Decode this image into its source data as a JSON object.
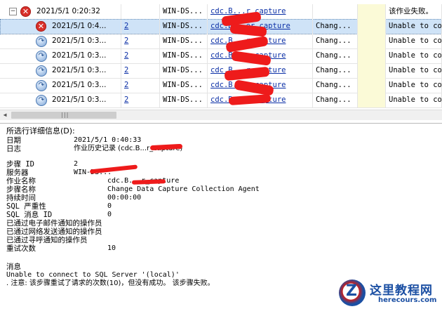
{
  "grid": {
    "rows": [
      {
        "kind": "job",
        "date": "2021/5/1 0:20:32",
        "step": "",
        "server": "WIN-DS...",
        "job": "cdc.B...r_capture",
        "name": "",
        "msg": "该作业失败。"
      },
      {
        "kind": "err",
        "date": "2021/5/1 0:4...",
        "step": "2",
        "server": "WIN-DS...",
        "job": "cdc.B...er_capture",
        "name": "Chang...",
        "msg": "Unable to co"
      },
      {
        "kind": "step",
        "date": "2021/5/1 0:3...",
        "step": "2",
        "server": "WIN-DS...",
        "job": "cdc.B...r_capture",
        "name": "Chang...",
        "msg": "Unable to co"
      },
      {
        "kind": "step",
        "date": "2021/5/1 0:3...",
        "step": "2",
        "server": "WIN-DS...",
        "job": "cdc.B...r_capture",
        "name": "Chang...",
        "msg": "Unable to co"
      },
      {
        "kind": "step",
        "date": "2021/5/1 0:3...",
        "step": "2",
        "server": "WIN-DS...",
        "job": "cdc.B...r_capture",
        "name": "Chang...",
        "msg": "Unable to co"
      },
      {
        "kind": "step",
        "date": "2021/5/1 0:3...",
        "step": "2",
        "server": "WIN-DS...",
        "job": "cdc.B...r_capture",
        "name": "Chang...",
        "msg": "Unable to co"
      },
      {
        "kind": "step",
        "date": "2021/5/1 0:3...",
        "step": "2",
        "server": "WIN-DS...",
        "job": "cdc.B...r_capture",
        "name": "Chang...",
        "msg": "Unable to co"
      }
    ],
    "expander_symbol": "−"
  },
  "detail": {
    "heading": "所选行详细信息(D):",
    "date_label": "日期",
    "date_value": "2021/5/1 0:40:33",
    "log_label": "日志",
    "log_value": "作业历史记录 (cdc.B...r_capture)",
    "step_id_label": "步骤 ID",
    "step_id_value": "2",
    "server_label": "服务器",
    "server_value": "WIN-DS...",
    "job_name_label": "作业名称",
    "job_name_value": "cdc.B...r_capture",
    "step_name_label": "步骤名称",
    "step_name_value": "Change Data Capture Collection Agent",
    "duration_label": "持续时间",
    "duration_value": "00:00:00",
    "severity_label": "SQL 严重性",
    "severity_value": "0",
    "msgid_label": "SQL 消息 ID",
    "msgid_value": "0",
    "notify_email_label": "已通过电子邮件通知的操作员",
    "notify_net_label": "已通过网络发送通知的操作员",
    "notify_pager_label": "已通过寻呼通知的操作员",
    "retries_label": "重试次数",
    "retries_value": "10",
    "message_label": "消息",
    "message_line1": "Unable to connect to SQL Server '(local)'",
    "message_line2": ".  注意: 该步骤重试了请求的次数(10)，但没有成功。  该步骤失败。"
  },
  "watermark": {
    "logo_letter": "Z",
    "title": "这里教程网",
    "url": "herecours.com"
  },
  "colors": {
    "selected_row": "#cfe3f7",
    "redaction": "#ee1b1b",
    "link": "#0b2fa6",
    "error_icon": "#d9302a",
    "watermark_blue": "#1b4fa3"
  }
}
